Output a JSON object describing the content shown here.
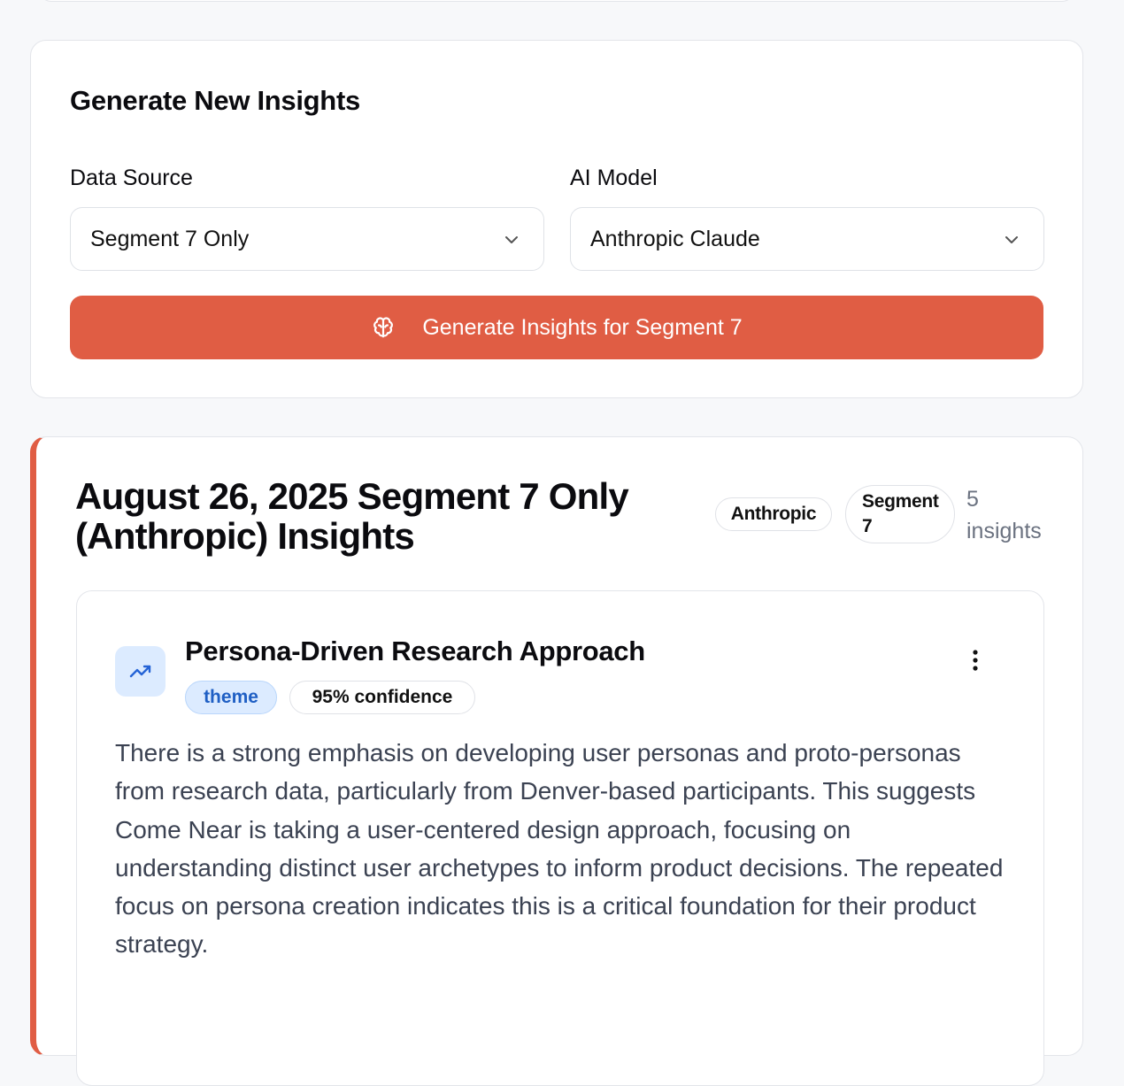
{
  "generator": {
    "title": "Generate New Insights",
    "data_source": {
      "label": "Data Source",
      "selected": "Segment 7 Only"
    },
    "ai_model": {
      "label": "AI Model",
      "selected": "Anthropic Claude"
    },
    "button_label": "Generate Insights for Segment 7"
  },
  "result": {
    "title": "August 26, 2025 Segment 7 Only (Anthropic) Insights",
    "badges": {
      "provider": "Anthropic",
      "segment": "Segment 7"
    },
    "count": "5 insights",
    "insight": {
      "icon": "trending-up-icon",
      "title": "Persona-Driven Research Approach",
      "type_tag": "theme",
      "confidence_tag": "95% confidence",
      "body": "There is a strong emphasis on developing user personas and proto-personas from research data, particularly from Denver-based participants. This suggests Come Near is taking a user-centered design approach, focusing on understanding distinct user archetypes to inform product decisions. The repeated focus on persona creation indicates this is a critical foundation for their product strategy."
    }
  },
  "colors": {
    "accent": "#e05d44",
    "theme_tag_bg": "#dcebff",
    "theme_tag_text": "#1f5fc4",
    "muted_text": "#6b7280"
  }
}
